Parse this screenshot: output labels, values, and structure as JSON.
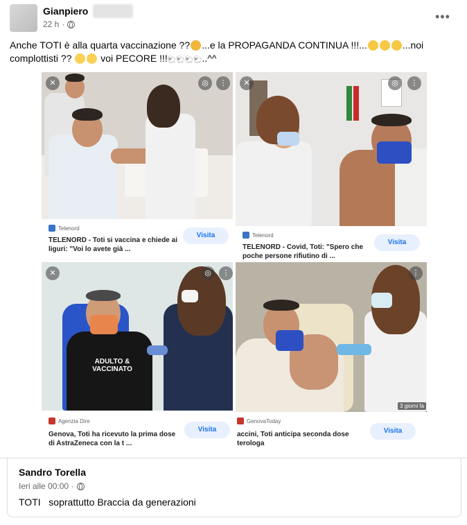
{
  "post": {
    "author": "Gianpiero",
    "time": "22 h",
    "privacy_icon": "globe-icon",
    "more_icon": "more-options-icon",
    "text": "Anche TOTI è alla quarta vaccinazione ??",
    "text_2": "...e la PROPAGANDA CONTINUA !!!...",
    "text_3": "...noi complottisti ?? ",
    "text_4": " voi PECORE !!!",
    "text_5": "..^^"
  },
  "results": [
    {
      "source": "Telenord",
      "headline_1": "TELENORD - Toti si vaccina e chiede ai",
      "headline_2": "liguri: \"Voi lo avete già ...",
      "button": "Visita"
    },
    {
      "source": "Telenord",
      "headline_1": "TELENORD - Covid, Toti: \"Spero che",
      "headline_2": "poche persone rifiutino di ...",
      "button": "Visita"
    },
    {
      "source": "Agenzia Dire",
      "headline_1": "Genova, Toti ha ricevuto la prima dose",
      "headline_2": "di AstraZeneca con la t ...",
      "button": "Visita",
      "shirt_text_1": "ADULTO &",
      "shirt_text_2": "VACCINATO"
    },
    {
      "source": "GenovaToday",
      "headline_1": "accini, Toti anticipa seconda dose",
      "headline_2": "terologa",
      "button": "Visita",
      "age": "3 giorni fa"
    }
  ],
  "comment": {
    "author": "Sandro Torella",
    "time": "Ieri alle 00:00",
    "text": "TOTI   soprattutto Braccia da generazioni"
  },
  "colors": {
    "link_blue": "#1a73e8",
    "button_bg": "#e8f0fe",
    "meta_gray": "#65676b",
    "mask_blue": "#2d4fc2",
    "mask_orange": "#e8854c"
  }
}
